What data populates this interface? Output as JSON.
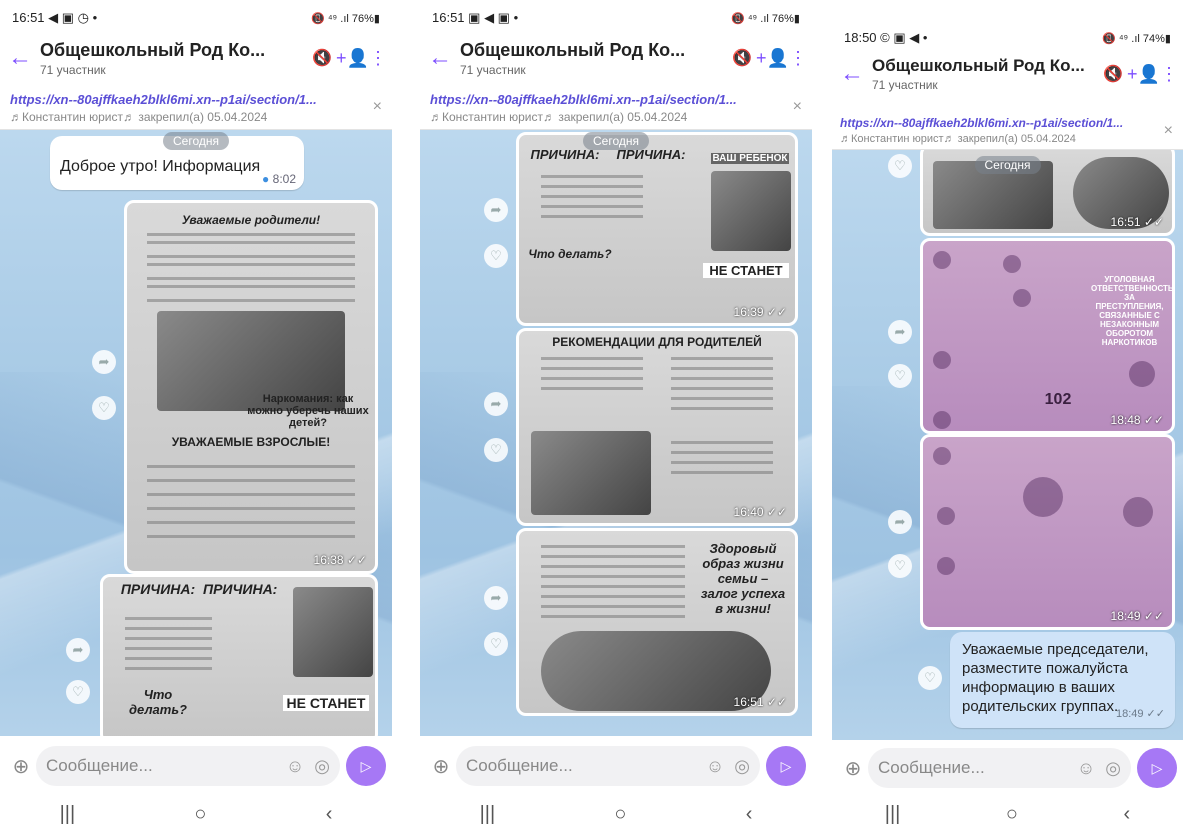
{
  "phones": [
    {
      "status_time": "16:51",
      "status_icons_left": "◀ ▣ ◷ •",
      "status_right": "📵 ⁴⁹ .ıl 76%▮",
      "chat_title": "Общешкольный Род Ко...",
      "members": "71 участник",
      "pinned_link": "https://xn--80ajffkaeh2blkl6mi.xn--p1ai/section/1...",
      "pinned_meta": "♬Константин юрист♬ закрепил(а) 05.04.2024",
      "date_label": "Сегодня",
      "message_text": "Доброе утро! Информация",
      "message_time": "8:02",
      "image_times": [
        "16:38 ✓✓"
      ],
      "doc_titles": [
        "Уважаемые родители!",
        "Наркомания: как можно уберечь наших детей?",
        "УВАЖАЕМЫЕ ВЗРОСЛЫЕ!",
        "ПРИЧИНА:",
        "ПРИЧИНА:",
        "Что делать?",
        "НЕ СТАНЕТ"
      ],
      "placeholder": "Сообщение..."
    },
    {
      "status_time": "16:51",
      "status_icons_left": "▣ ◀ ▣ •",
      "status_right": "📵 ⁴⁹ .ıl 76%▮",
      "chat_title": "Общешкольный Род Ко...",
      "members": "71 участник",
      "pinned_link": "https://xn--80ajffkaeh2blkl6mi.xn--p1ai/section/1...",
      "pinned_meta": "♬Константин юрист♬ закрепил(а) 05.04.2024",
      "date_label": "Сегодня",
      "image_times": [
        "16:39 ✓✓",
        "16:40 ✓✓",
        "16:51 ✓✓"
      ],
      "doc_titles": [
        "ПРИЧИНА:",
        "ПРИЧИНА:",
        "ВАШ РЕБЕНОК",
        "Что делать?",
        "НЕ СТАНЕТ",
        "РЕКОМЕНДАЦИИ ДЛЯ РОДИТЕЛЕЙ",
        "Здоровый образ жизни семьи – залог успеха в жизни!"
      ],
      "placeholder": "Сообщение..."
    },
    {
      "status_time": "18:50",
      "status_icons_left": "© ▣ ◀ •",
      "status_right": "📵 ⁴⁹ .ıl 74%▮",
      "chat_title": "Общешкольный Род Ко...",
      "members": "71 участник",
      "pinned_link": "https://xn--80ajffkaeh2blkl6mi.xn--p1ai/section/1...",
      "pinned_meta": "♬Константин юрист♬ закрепил(а) 05.04.2024",
      "date_label": "Сегодня",
      "image_times": [
        "16:51 ✓✓",
        "18:48 ✓✓",
        "18:49 ✓✓"
      ],
      "doc_titles": [
        "УГОЛОВНАЯ ОТВЕТСТВЕННОСТЬ ЗА ПРЕСТУПЛЕНИЯ, СВЯЗАННЫЕ С НЕЗАКОННЫМ ОБОРОТОМ НАРКОТИКОВ",
        "102"
      ],
      "message_text": "Уважаемые председатели, разместите пожалуйста информацию в ваших родительских группах.",
      "message_time": "18:49 ✓✓",
      "placeholder": "Сообщение..."
    }
  ],
  "icons": {
    "back": "←",
    "mute": "🔇",
    "add_user": "+👤",
    "more": "⋮",
    "close": "×",
    "share": "➦",
    "like": "♡",
    "plus": "⊕",
    "emoji": "☺",
    "sticker": "◎",
    "send": "▷",
    "nav_recent": "|||",
    "nav_home": "○",
    "nav_back": "‹"
  }
}
